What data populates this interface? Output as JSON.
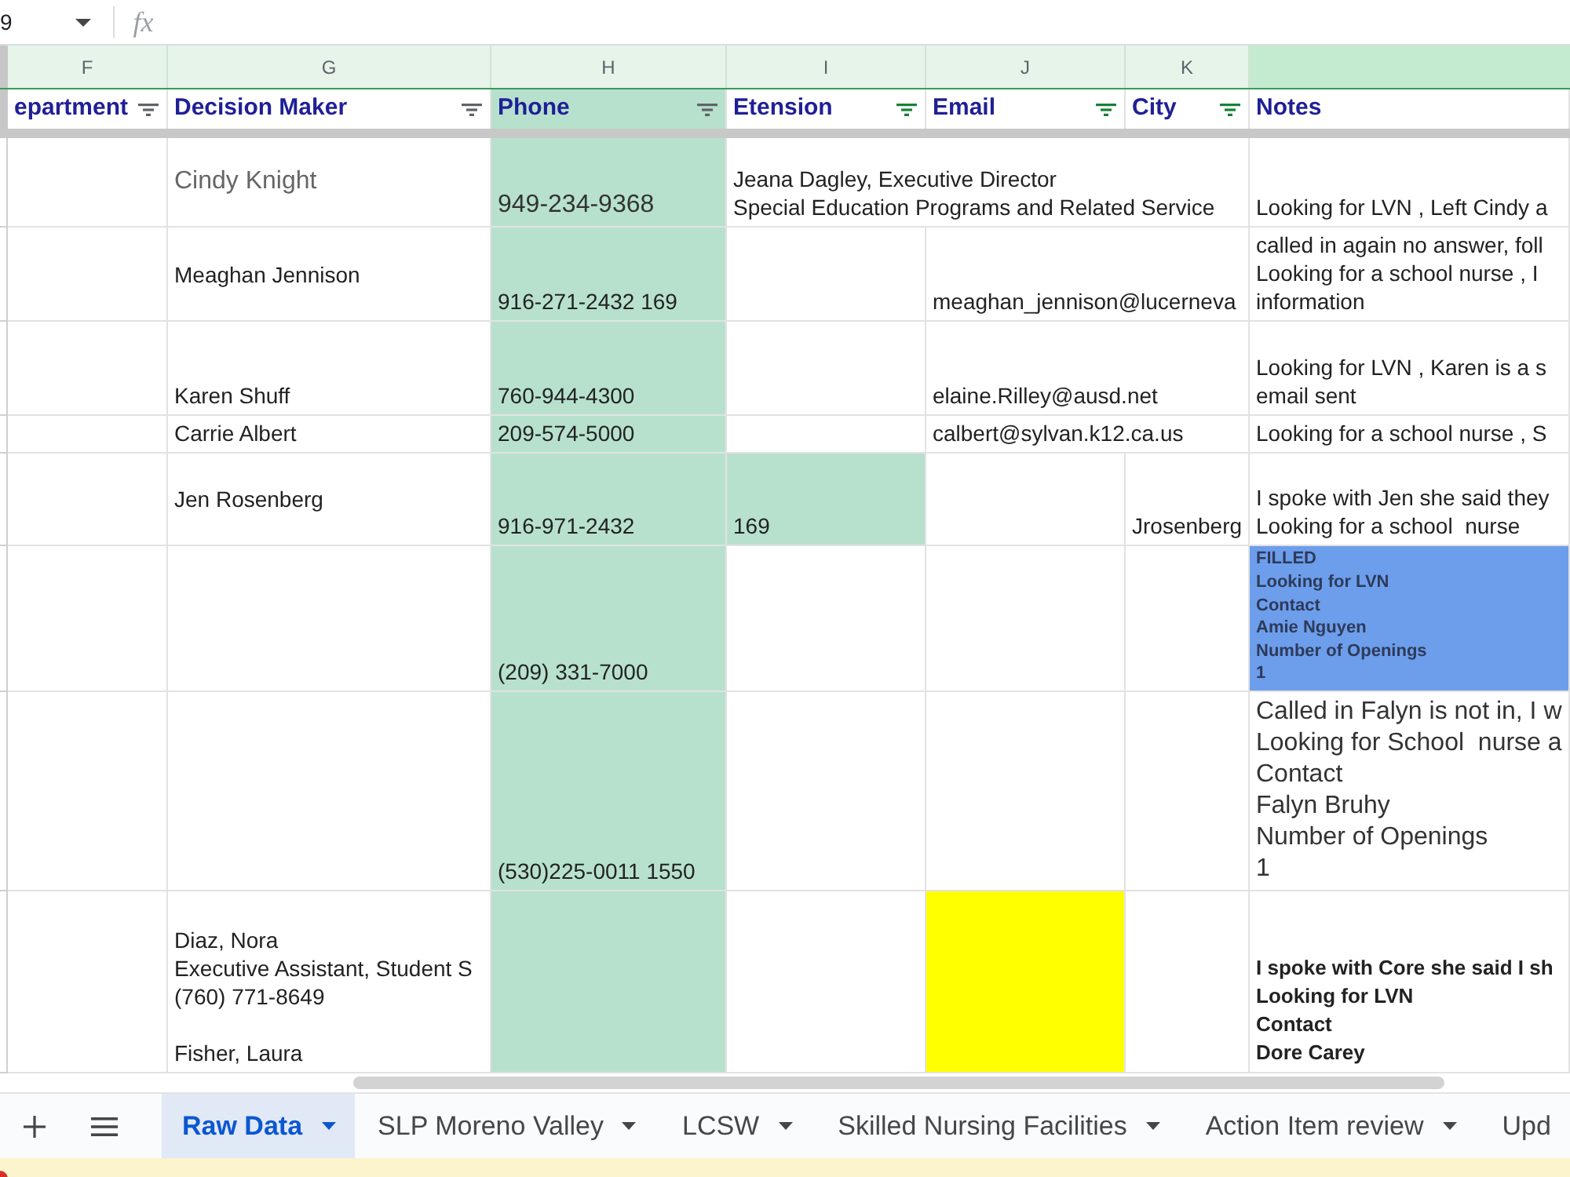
{
  "formula_bar": {
    "cell_reference": "9",
    "formula_label": "fx"
  },
  "column_letters": [
    "F",
    "G",
    "H",
    "I",
    "J",
    "K"
  ],
  "header_row": [
    {
      "label": "epartment",
      "filtered": false
    },
    {
      "label": "Decision Maker",
      "filtered": false
    },
    {
      "label": "Phone",
      "filtered": false,
      "color": "#b7e1cd"
    },
    {
      "label": "Etension",
      "filtered": true
    },
    {
      "label": "Email",
      "filtered": true
    },
    {
      "label": "City",
      "filtered": true
    },
    {
      "label": "Notes"
    }
  ],
  "rows": [
    {
      "cells": {
        "decision_maker": {
          "text": "Cindy Knight",
          "kind": "muted"
        },
        "phone": {
          "text": "949-234-9368",
          "kind": "large",
          "color": "#b7e1cd"
        },
        "extension": {
          "text": "Jeana Dagley, Executive Director\nSpecial Education Programs and Related Service",
          "kind": "plain"
        },
        "notes": {
          "text": "Looking for LVN , Left Cindy a",
          "kind": "plain"
        }
      }
    },
    {
      "cells": {
        "decision_maker": {
          "text": "Meaghan Jennison",
          "kind": "plain"
        },
        "phone": {
          "text": "916-271-2432 169",
          "kind": "plain",
          "color": "#b7e1cd"
        },
        "email": {
          "text": "meaghan_jennison@lucerneva",
          "kind": "plain"
        },
        "notes": {
          "text": "called in again no answer, foll\nLooking for a school nurse , I\ninformation",
          "kind": "plain"
        }
      }
    },
    {
      "cells": {
        "decision_maker": {
          "text": "Karen Shuff",
          "kind": "plain"
        },
        "phone": {
          "text": "760-944-4300",
          "kind": "plain",
          "color": "#b7e1cd"
        },
        "email": {
          "text": "elaine.Rilley@ausd.net",
          "kind": "plain"
        },
        "notes": {
          "text": "Looking for LVN , Karen is a s\nemail sent",
          "kind": "plain"
        }
      }
    },
    {
      "cells": {
        "decision_maker": {
          "text": "Carrie Albert",
          "kind": "plain"
        },
        "phone": {
          "text": "209-574-5000",
          "kind": "plain",
          "color": "#b7e1cd"
        },
        "email": {
          "text": "calbert@sylvan.k12.ca.us",
          "kind": "plain"
        },
        "notes": {
          "text": "Looking for a school nurse , S",
          "kind": "plain"
        }
      }
    },
    {
      "cells": {
        "decision_maker": {
          "text": "Jen Rosenberg",
          "kind": "plain"
        },
        "phone": {
          "text": "916-971-2432",
          "kind": "plain",
          "color": "#b7e1cd"
        },
        "extension": {
          "text": "169",
          "kind": "plain",
          "color": "#b7e1cd"
        },
        "city": {
          "text": "Jrosenberg",
          "kind": "plain"
        },
        "notes": {
          "text": "I spoke with Jen she said they\nLooking for a school  nurse",
          "kind": "plain"
        }
      }
    },
    {
      "cells": {
        "phone": {
          "text": "(209) 331-7000",
          "kind": "plain",
          "color": "#b7e1cd"
        },
        "notes": {
          "text": "FILLED\nLooking for LVN\nContact\nAmie Nguyen\nNumber of Openings\n1",
          "kind": "tiny",
          "color": "#6d9eeb"
        }
      }
    },
    {
      "cells": {
        "phone": {
          "text": "(530)225-0011 1550",
          "kind": "plain",
          "color": "#b7e1cd"
        },
        "notes": {
          "text": "Called in Falyn is not in, I w\nLooking for School  nurse a\nContact\nFalyn Bruhy\nNumber of Openings\n1",
          "kind": "large"
        }
      }
    },
    {
      "cells": {
        "decision_maker": {
          "text": "Diaz, Nora\nExecutive Assistant, Student S\n(760) 771-8649\n\nFisher, Laura",
          "kind": "plain"
        },
        "phone": {
          "color": "#b7e1cd"
        },
        "email": {
          "color": "#ffff00"
        },
        "notes": {
          "text": "I spoke with Core she said I sh\nLooking for LVN\nContact\nDore Carey",
          "kind": "bold"
        }
      }
    }
  ],
  "tabs": [
    {
      "label": "Raw Data",
      "selected": true
    },
    {
      "label": "SLP Moreno Valley",
      "selected": false
    },
    {
      "label": "LCSW",
      "selected": false
    },
    {
      "label": "Skilled Nursing Facilities",
      "selected": false
    },
    {
      "label": "Action Item review",
      "selected": false
    },
    {
      "label": "Upd",
      "selected": false
    }
  ]
}
